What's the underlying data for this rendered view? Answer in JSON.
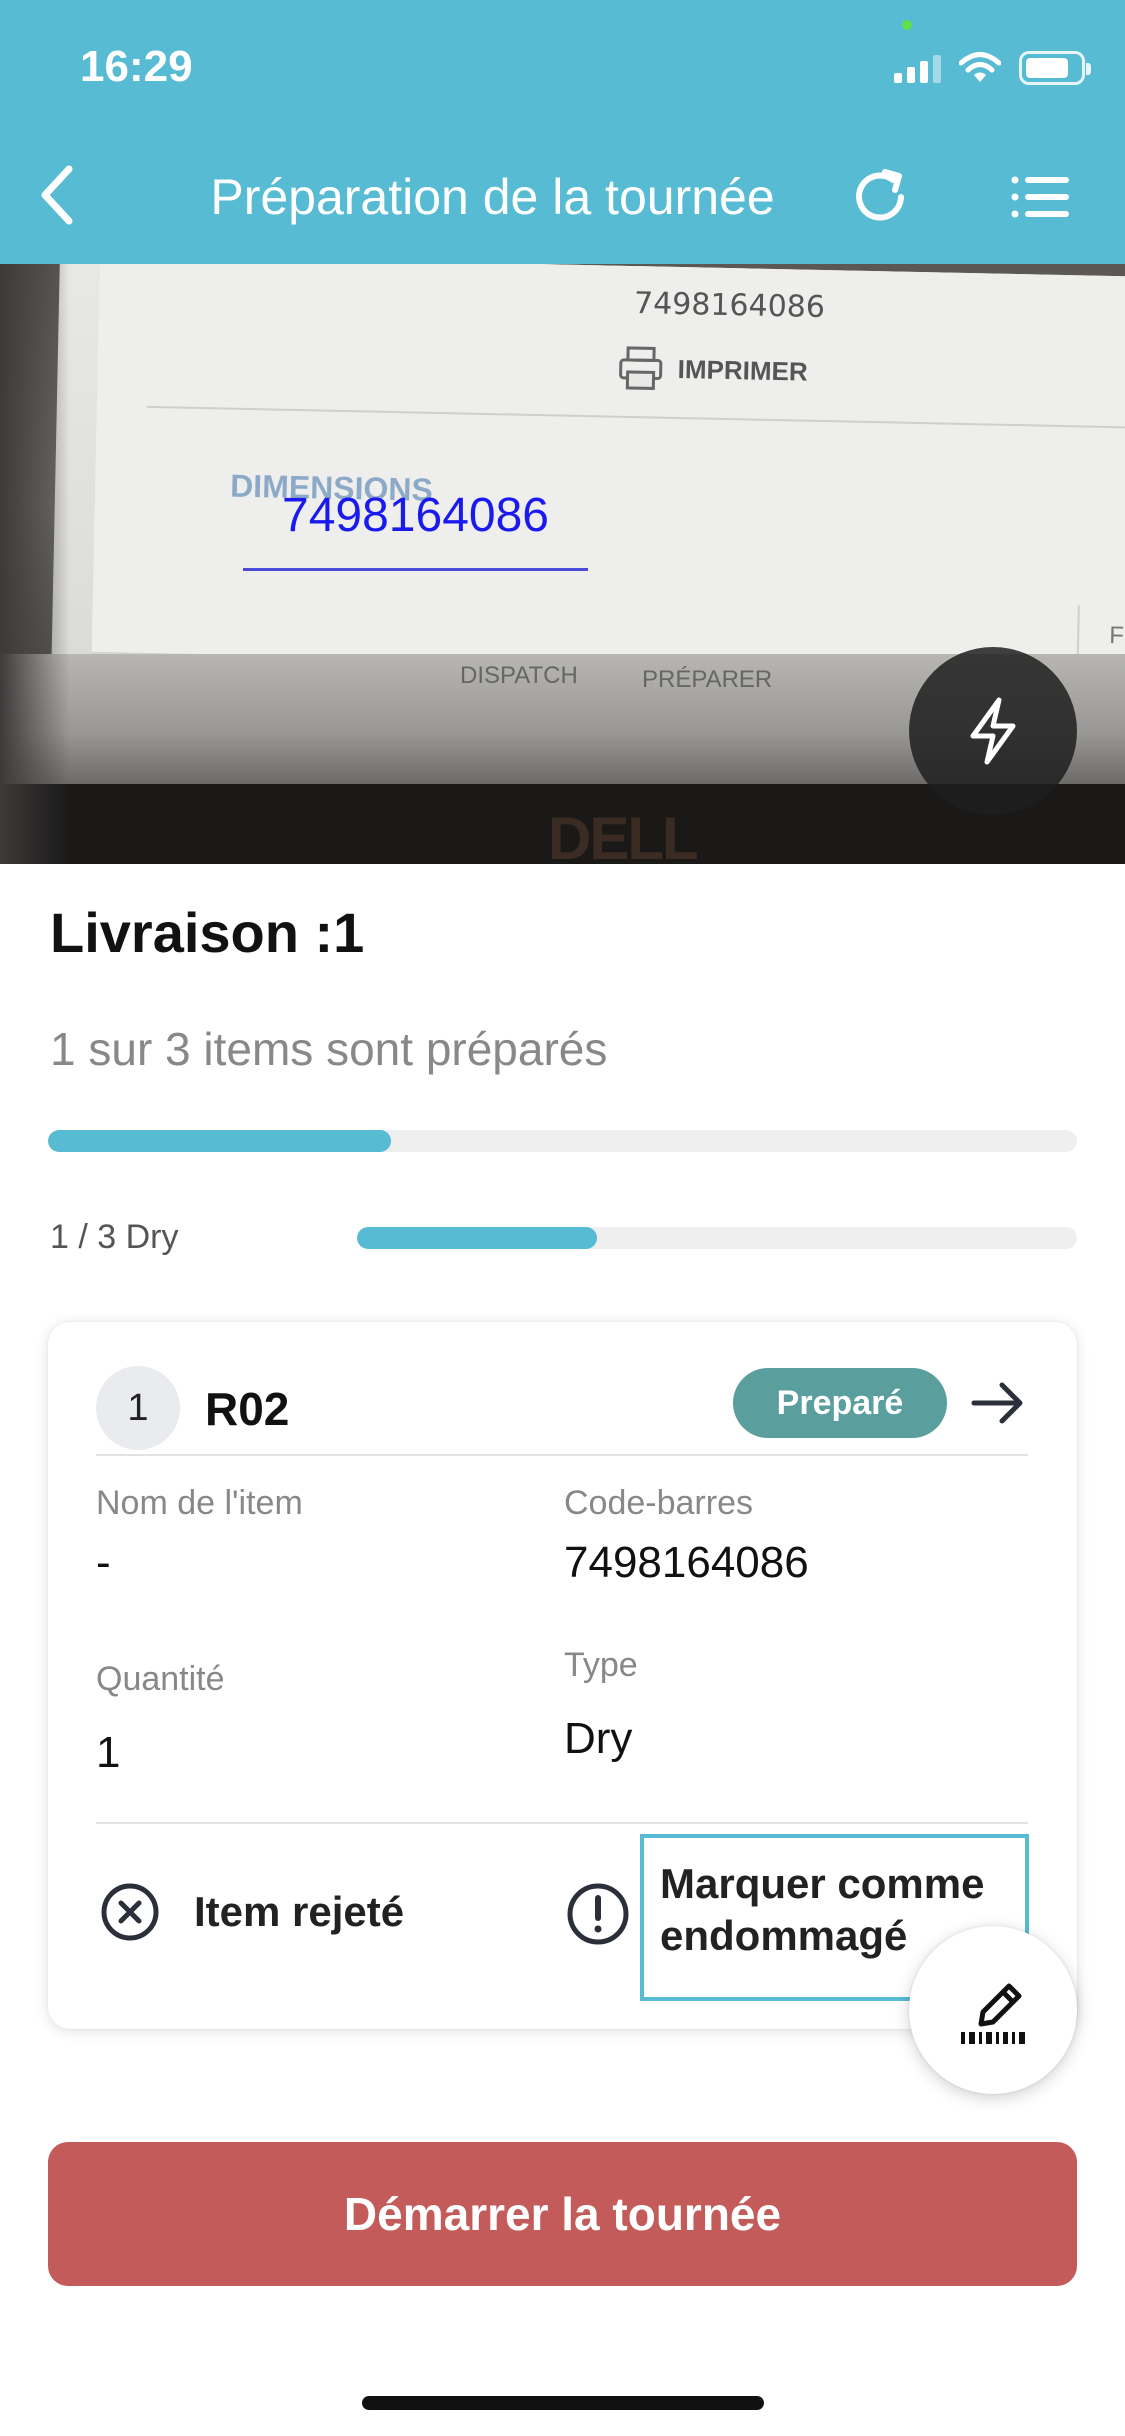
{
  "status_bar": {
    "time": "16:29"
  },
  "header": {
    "title": "Préparation de la tournée"
  },
  "camera": {
    "background_barcode": "7498164086",
    "background_print": "IMPRIMER",
    "background_dimensions": "DIMENSIONS",
    "background_dispatch": "DISPATCH",
    "background_preparer": "PRÉPARER",
    "background_close": "FERM",
    "background_brand": "DELL",
    "scanned_code": "7498164086"
  },
  "delivery": {
    "title": "Livraison :1",
    "summary": "1 sur 3 items sont préparés",
    "progress_fraction": 0.333,
    "type_progress_label": "1 / 3 Dry",
    "type_progress_fraction": 0.333
  },
  "item": {
    "index": "1",
    "reference": "R02",
    "status": "Preparé",
    "name_label": "Nom de l'item",
    "name_value": "-",
    "barcode_label": "Code-barres",
    "barcode_value": "7498164086",
    "quantity_label": "Quantité",
    "quantity_value": "1",
    "type_label": "Type",
    "type_value": "Dry",
    "reject_label": "Item rejeté",
    "damage_label": "Marquer comme endommagé"
  },
  "footer": {
    "start_button": "Démarrer la tournée"
  },
  "colors": {
    "header": "#56bbd3",
    "progress": "#56bbd3",
    "badge": "#5a9e9e",
    "start_button": "#c45b5b",
    "scanned_text": "#1a1aee"
  },
  "icons": [
    "back-icon",
    "refresh-icon",
    "list-menu-icon",
    "flash-icon",
    "arrow-right-icon",
    "reject-icon",
    "warning-icon",
    "edit-barcode-icon"
  ]
}
